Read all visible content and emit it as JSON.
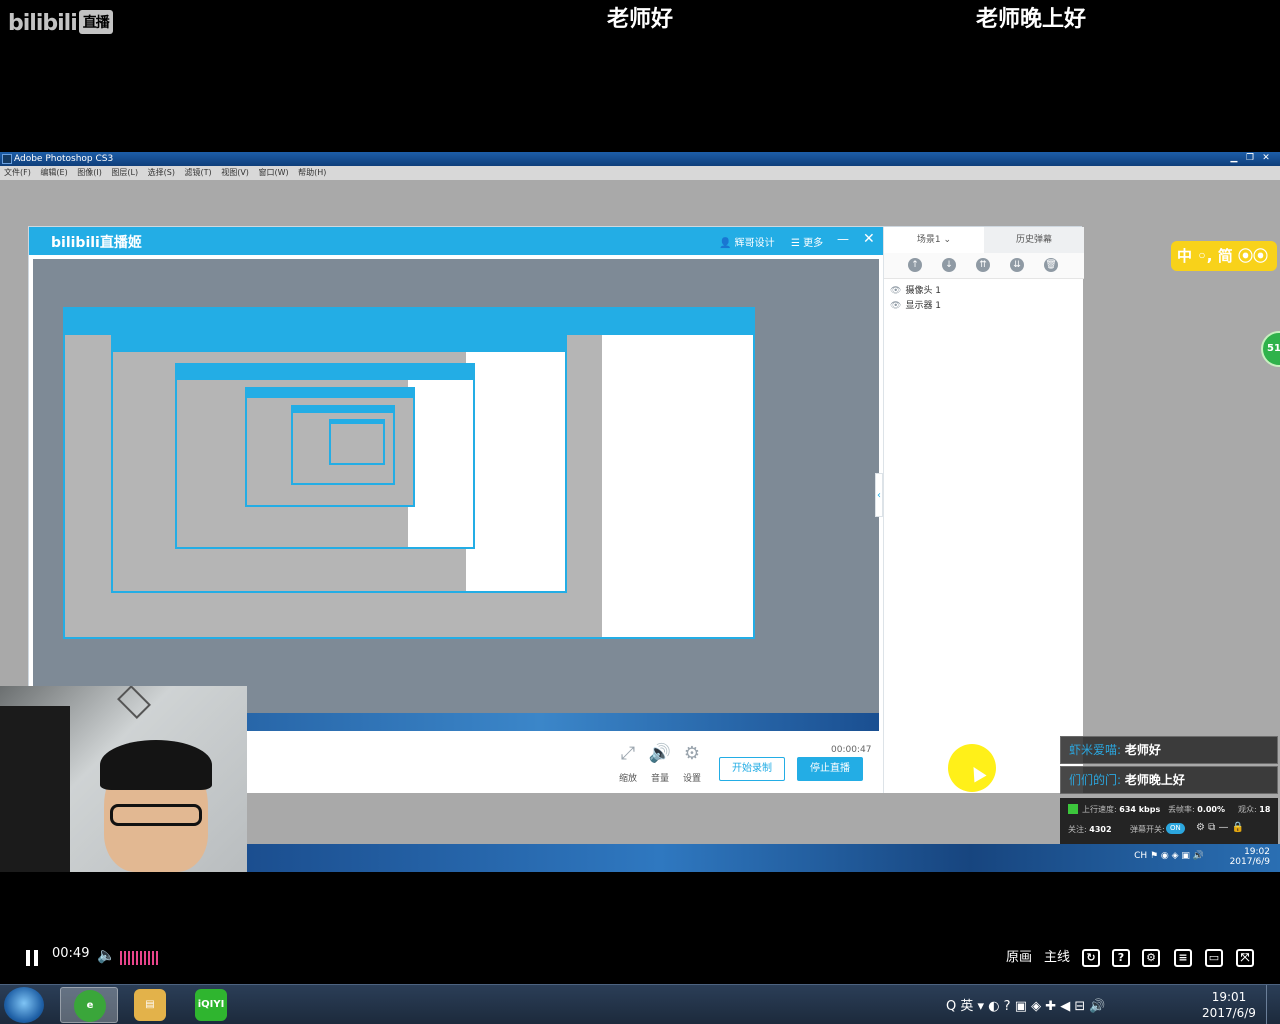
{
  "overlay": {
    "site_logo": "bilibili",
    "site_badge": "直播",
    "danmaku": [
      "老师好",
      "老师晚上好"
    ]
  },
  "photoshop": {
    "title": "Adobe Photoshop CS3",
    "menu": [
      "文件(F)",
      "编辑(E)",
      "图像(I)",
      "图层(L)",
      "选择(S)",
      "滤镜(T)",
      "视图(V)",
      "窗口(W)",
      "帮助(H)"
    ]
  },
  "live_app": {
    "logo": "bilibili直播姬",
    "user": "辉哥设计",
    "more": "更多",
    "timer": "00:00:47",
    "controls": [
      "缩放",
      "音量",
      "设置"
    ],
    "start_record": "开始录制",
    "stop_live": "停止直播",
    "scene_tab": "场景1",
    "history_tab": "历史弹幕",
    "sources": [
      "摄像头 1",
      "显示器 1"
    ]
  },
  "ime_widget": {
    "text": "中 ◦, 简"
  },
  "green_ball": "51",
  "danmaku_panel": {
    "rows": [
      {
        "user": "虾米爱喵:",
        "msg": "老师好"
      },
      {
        "user": "们们的门:",
        "msg": "老师晚上好"
      }
    ],
    "upload_label": "上行速度:",
    "upload_value": "634 kbps",
    "drop_label": "丢帧率:",
    "drop_value": "0.00%",
    "viewers_label": "观众:",
    "viewers_value": "18",
    "follow_label": "关注:",
    "follow_value": "4302",
    "toggle_label": "弹幕开关:",
    "toggle_value": "ON"
  },
  "video_taskbar": {
    "lang": "CH",
    "time": "19:02",
    "date": "2017/6/9"
  },
  "player": {
    "time": "00:49",
    "quality": "原画",
    "line": "主线"
  },
  "taskbar": {
    "tray_lang": "英",
    "time": "19:01",
    "date": "2017/6/9"
  },
  "colors": {
    "bili_blue": "#23ade5",
    "danmaku_pink": "#e8458b"
  }
}
